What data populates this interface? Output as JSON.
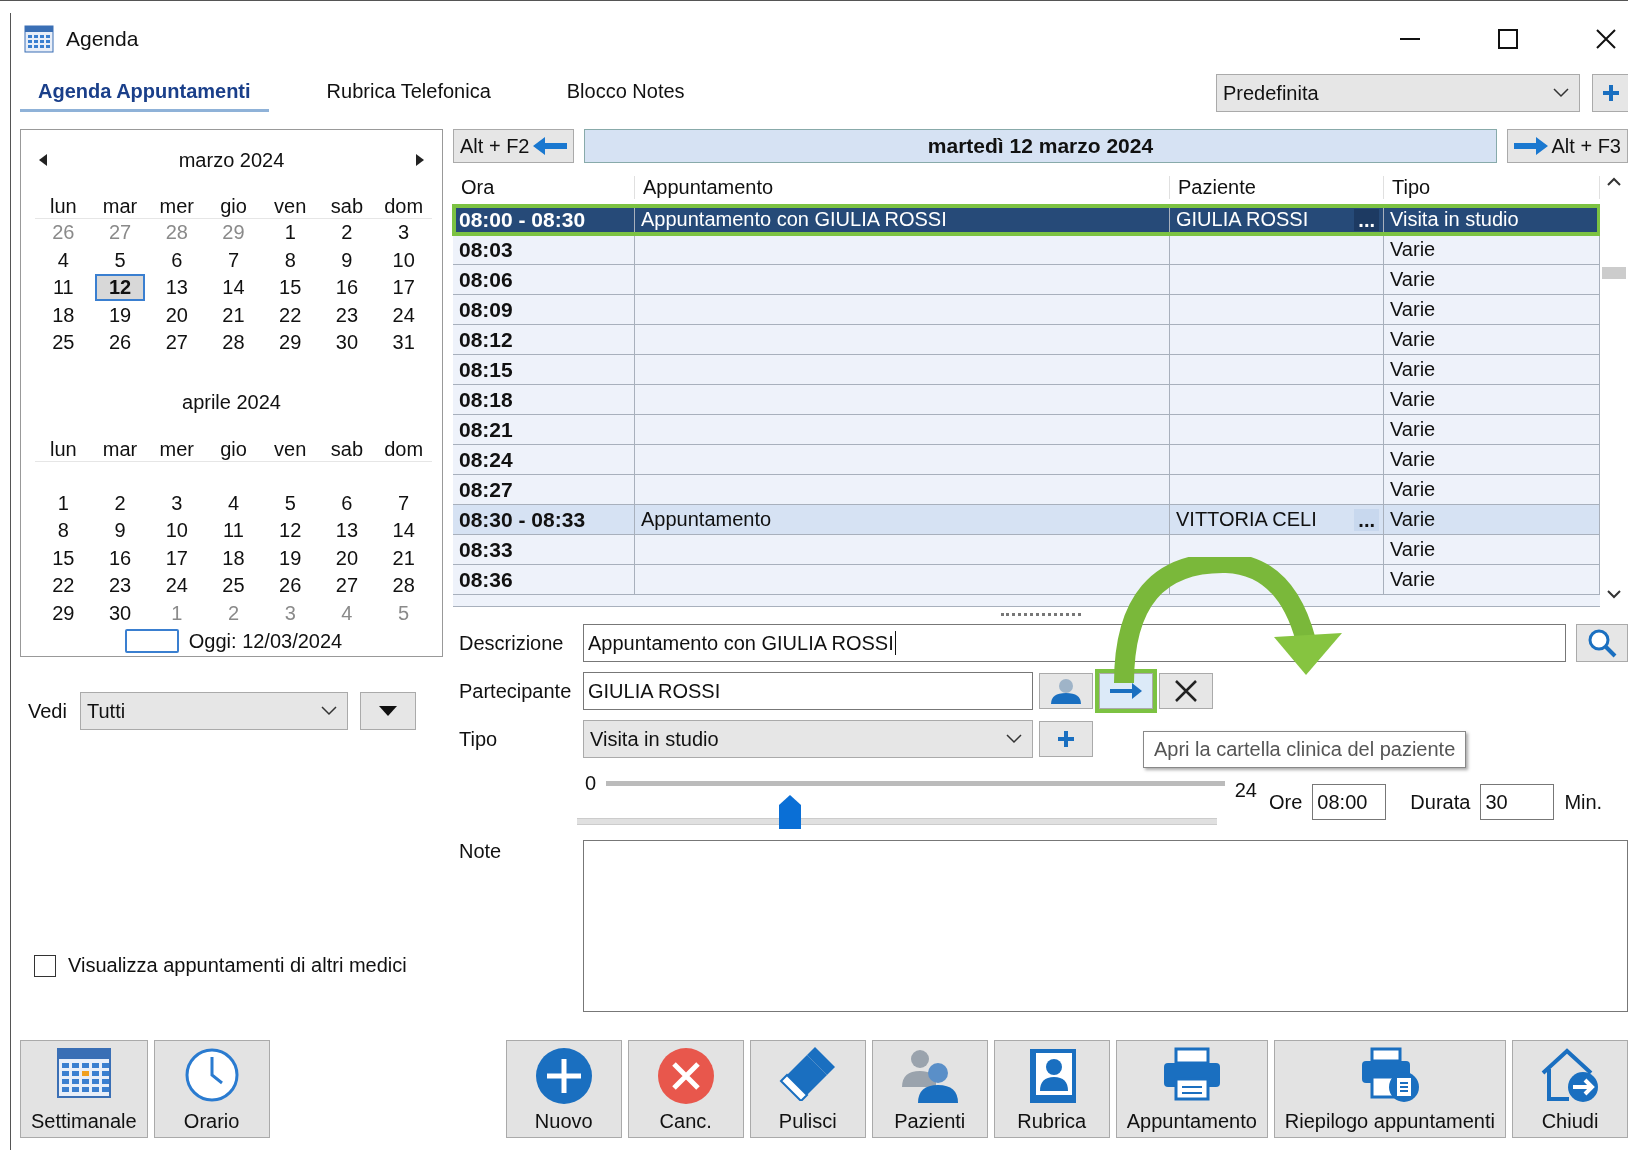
{
  "window": {
    "title": "Agenda"
  },
  "tabs": [
    {
      "label": "Agenda Appuntamenti",
      "selected": true
    },
    {
      "label": "Rubrica Telefonica",
      "selected": false
    },
    {
      "label": "Blocco Notes",
      "selected": false
    }
  ],
  "view_select": {
    "value": "Predefinita"
  },
  "calendars": [
    {
      "title": "marzo 2024",
      "weekdays": [
        "lun",
        "mar",
        "mer",
        "gio",
        "ven",
        "sab",
        "dom"
      ],
      "weeks": [
        [
          {
            "d": "26",
            "other": true,
            "selected": false
          },
          {
            "d": "27",
            "other": true,
            "selected": false
          },
          {
            "d": "28",
            "other": true,
            "selected": false
          },
          {
            "d": "29",
            "other": true,
            "selected": false
          },
          {
            "d": "1",
            "other": false,
            "selected": false
          },
          {
            "d": "2",
            "other": false,
            "selected": false
          },
          {
            "d": "3",
            "other": false,
            "selected": false
          }
        ],
        [
          {
            "d": "4",
            "other": false,
            "selected": false
          },
          {
            "d": "5",
            "other": false,
            "selected": false
          },
          {
            "d": "6",
            "other": false,
            "selected": false
          },
          {
            "d": "7",
            "other": false,
            "selected": false
          },
          {
            "d": "8",
            "other": false,
            "selected": false
          },
          {
            "d": "9",
            "other": false,
            "selected": false
          },
          {
            "d": "10",
            "other": false,
            "selected": false
          }
        ],
        [
          {
            "d": "11",
            "other": false,
            "selected": false
          },
          {
            "d": "12",
            "other": false,
            "selected": true
          },
          {
            "d": "13",
            "other": false,
            "selected": false
          },
          {
            "d": "14",
            "other": false,
            "selected": false
          },
          {
            "d": "15",
            "other": false,
            "selected": false
          },
          {
            "d": "16",
            "other": false,
            "selected": false
          },
          {
            "d": "17",
            "other": false,
            "selected": false
          }
        ],
        [
          {
            "d": "18",
            "other": false,
            "selected": false
          },
          {
            "d": "19",
            "other": false,
            "selected": false
          },
          {
            "d": "20",
            "other": false,
            "selected": false
          },
          {
            "d": "21",
            "other": false,
            "selected": false
          },
          {
            "d": "22",
            "other": false,
            "selected": false
          },
          {
            "d": "23",
            "other": false,
            "selected": false
          },
          {
            "d": "24",
            "other": false,
            "selected": false
          }
        ],
        [
          {
            "d": "25",
            "other": false,
            "selected": false
          },
          {
            "d": "26",
            "other": false,
            "selected": false
          },
          {
            "d": "27",
            "other": false,
            "selected": false
          },
          {
            "d": "28",
            "other": false,
            "selected": false
          },
          {
            "d": "29",
            "other": false,
            "selected": false
          },
          {
            "d": "30",
            "other": false,
            "selected": false
          },
          {
            "d": "31",
            "other": false,
            "selected": false
          }
        ]
      ]
    },
    {
      "title": "aprile 2024",
      "weekdays": [
        "lun",
        "mar",
        "mer",
        "gio",
        "ven",
        "sab",
        "dom"
      ],
      "weeks": [
        [
          {
            "d": "1",
            "other": false,
            "selected": false
          },
          {
            "d": "2",
            "other": false,
            "selected": false
          },
          {
            "d": "3",
            "other": false,
            "selected": false
          },
          {
            "d": "4",
            "other": false,
            "selected": false
          },
          {
            "d": "5",
            "other": false,
            "selected": false
          },
          {
            "d": "6",
            "other": false,
            "selected": false
          },
          {
            "d": "7",
            "other": false,
            "selected": false
          }
        ],
        [
          {
            "d": "8",
            "other": false,
            "selected": false
          },
          {
            "d": "9",
            "other": false,
            "selected": false
          },
          {
            "d": "10",
            "other": false,
            "selected": false
          },
          {
            "d": "11",
            "other": false,
            "selected": false
          },
          {
            "d": "12",
            "other": false,
            "selected": false
          },
          {
            "d": "13",
            "other": false,
            "selected": false
          },
          {
            "d": "14",
            "other": false,
            "selected": false
          }
        ],
        [
          {
            "d": "15",
            "other": false,
            "selected": false
          },
          {
            "d": "16",
            "other": false,
            "selected": false
          },
          {
            "d": "17",
            "other": false,
            "selected": false
          },
          {
            "d": "18",
            "other": false,
            "selected": false
          },
          {
            "d": "19",
            "other": false,
            "selected": false
          },
          {
            "d": "20",
            "other": false,
            "selected": false
          },
          {
            "d": "21",
            "other": false,
            "selected": false
          }
        ],
        [
          {
            "d": "22",
            "other": false,
            "selected": false
          },
          {
            "d": "23",
            "other": false,
            "selected": false
          },
          {
            "d": "24",
            "other": false,
            "selected": false
          },
          {
            "d": "25",
            "other": false,
            "selected": false
          },
          {
            "d": "26",
            "other": false,
            "selected": false
          },
          {
            "d": "27",
            "other": false,
            "selected": false
          },
          {
            "d": "28",
            "other": false,
            "selected": false
          }
        ],
        [
          {
            "d": "29",
            "other": false,
            "selected": false
          },
          {
            "d": "30",
            "other": false,
            "selected": false
          },
          {
            "d": "1",
            "other": true,
            "selected": false
          },
          {
            "d": "2",
            "other": true,
            "selected": false
          },
          {
            "d": "3",
            "other": true,
            "selected": false
          },
          {
            "d": "4",
            "other": true,
            "selected": false
          },
          {
            "d": "5",
            "other": true,
            "selected": false
          }
        ]
      ]
    }
  ],
  "today": "Oggi: 12/03/2024",
  "filter": {
    "label": "Vedi",
    "value": "Tutti"
  },
  "other_doctors": {
    "label": "Visualizza appuntamenti di altri medici",
    "checked": false
  },
  "navigator": {
    "prev": "Alt + F2",
    "date": "martedì 12 marzo 2024",
    "next": "Alt + F3"
  },
  "table": {
    "columns": [
      "Ora",
      "Appuntamento",
      "Paziente",
      "Tipo"
    ],
    "rows": [
      {
        "kind": "selected",
        "highlighted": true,
        "time": "08:00 - 08:30",
        "appointment": "Appuntamento con GIULIA ROSSI",
        "patient": "GIULIA ROSSI",
        "more": "...",
        "type": "Visita in studio"
      },
      {
        "kind": "slot",
        "highlighted": false,
        "time": "08:03",
        "type": "Varie"
      },
      {
        "kind": "slot",
        "highlighted": false,
        "time": "08:06",
        "type": "Varie"
      },
      {
        "kind": "slot",
        "highlighted": false,
        "time": "08:09",
        "type": "Varie"
      },
      {
        "kind": "slot",
        "highlighted": false,
        "time": "08:12",
        "type": "Varie"
      },
      {
        "kind": "slot",
        "highlighted": false,
        "time": "08:15",
        "type": "Varie"
      },
      {
        "kind": "slot",
        "highlighted": false,
        "time": "08:18",
        "type": "Varie"
      },
      {
        "kind": "slot",
        "highlighted": false,
        "time": "08:21",
        "type": "Varie"
      },
      {
        "kind": "slot",
        "highlighted": false,
        "time": "08:24",
        "type": "Varie"
      },
      {
        "kind": "slot",
        "highlighted": false,
        "time": "08:27",
        "type": "Varie"
      },
      {
        "kind": "appointment",
        "highlighted": false,
        "time": "08:30 - 08:33",
        "appointment": "Appuntamento",
        "patient": "VITTORIA CELI",
        "more": "...",
        "type": "Varie"
      },
      {
        "kind": "slot",
        "highlighted": false,
        "time": "08:33",
        "type": "Varie"
      },
      {
        "kind": "slot",
        "highlighted": false,
        "time": "08:36",
        "type": "Varie"
      }
    ]
  },
  "form": {
    "description_label": "Descrizione",
    "description": "Appuntamento con GIULIA ROSSI",
    "participant_label": "Partecipante",
    "participant": "GIULIA ROSSI",
    "open_record_highlighted": true,
    "type_label": "Tipo",
    "type": "Visita in studio",
    "scale_min": "0",
    "scale_max": "24",
    "time_slider": {
      "level": 0.333
    },
    "hours_label": "Ore",
    "hours": "08:00",
    "duration_label": "Durata",
    "duration": "30",
    "minutes_label": "Min.",
    "notes_label": "Note"
  },
  "tooltip": "Apri la cartella clinica del paziente",
  "toolbar_left": [
    {
      "label": "Settimanale"
    },
    {
      "label": "Orario"
    }
  ],
  "toolbar_right": [
    {
      "label": "Nuovo"
    },
    {
      "label": "Canc."
    },
    {
      "label": "Pulisci"
    },
    {
      "label": "Pazienti"
    },
    {
      "label": "Rubrica"
    },
    {
      "label": "Appuntamento"
    },
    {
      "label": "Riepilogo appuntamenti"
    },
    {
      "label": "Chiudi"
    }
  ]
}
